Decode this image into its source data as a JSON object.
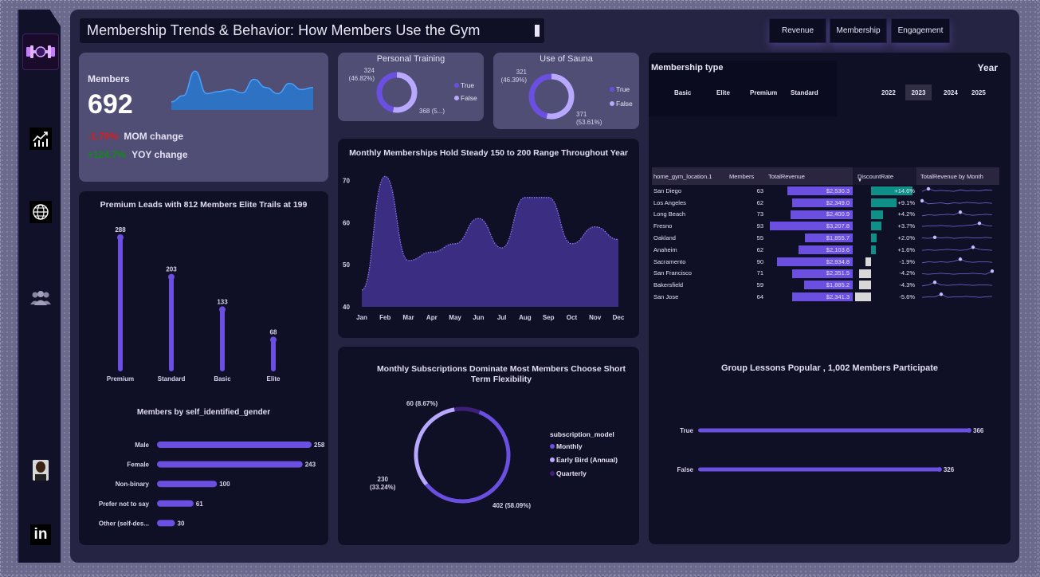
{
  "colors": {
    "accent": "#6a4fe0",
    "accent_light": "#b9a8ff",
    "accent_dark": "#3e1f78",
    "negative": "#e01b1b",
    "positive": "#0f8a1a",
    "teal": "#0e8f87",
    "panel": "#0f0f26",
    "kpi_panel": "#504e74"
  },
  "title": "Membership Trends  & Behavior: How Members Use the Gym",
  "nav_buttons": [
    "Revenue",
    "Membership",
    "Engagement"
  ],
  "sidebar_icons": [
    "gym-logo-icon",
    "line-chart-icon",
    "globe-icon",
    "users-icon",
    "profile-photo",
    "linkedin-icon"
  ],
  "kpi": {
    "label": "Members",
    "value": "692",
    "mom_value": "-1.70%",
    "mom_label": "MOM change",
    "yoy_value": "+124.7%",
    "yoy_label": "YOY change"
  },
  "personal_training": {
    "title": "Personal Training",
    "true_label": "324\n(46.82%)",
    "false_label": "368 (5...)",
    "legend": [
      "True",
      "False"
    ],
    "chart_data": {
      "type": "pie",
      "categories": [
        "True",
        "False"
      ],
      "values": [
        324,
        368
      ]
    }
  },
  "sauna": {
    "title": "Use of Sauna",
    "true_label": "321\n(46.39%)",
    "false_label": "371\n(53.61%)",
    "legend": [
      "True",
      "False"
    ],
    "chart_data": {
      "type": "pie",
      "categories": [
        "True",
        "False"
      ],
      "values": [
        321,
        371
      ]
    }
  },
  "membership_type": {
    "title": "Membership type",
    "options": [
      "Basic",
      "Elite",
      "Premium",
      "Standard"
    ]
  },
  "year": {
    "title": "Year",
    "options": [
      "2022",
      "2023",
      "2024",
      "2025"
    ],
    "selected": "2023"
  },
  "premium_chart": {
    "title": "Premium Leads with 812 Members Elite Trails at 199",
    "chart_data": {
      "type": "bar",
      "categories": [
        "Premium",
        "Standard",
        "Basic",
        "Elite"
      ],
      "values": [
        288,
        203,
        133,
        68
      ]
    }
  },
  "monthly_chart": {
    "title": "Monthly Memberships Hold Steady 150 to 200 Range Throughout Year",
    "chart_data": {
      "type": "area",
      "categories": [
        "Jan",
        "Feb",
        "Mar",
        "Apr",
        "May",
        "Jun",
        "Jul",
        "Aug",
        "Sep",
        "Oct",
        "Nov",
        "Dec"
      ],
      "values": [
        44,
        71,
        51,
        53,
        55,
        61,
        54,
        66,
        66,
        55,
        59,
        56
      ],
      "y_ticks": [
        "70",
        "60",
        "50",
        "40"
      ],
      "ylim": [
        40,
        72
      ]
    }
  },
  "gender_chart": {
    "title": "Members by self_identified_gender",
    "chart_data": {
      "type": "bar",
      "categories": [
        "Male",
        "Female",
        "Non-binary",
        "Prefer not to say",
        "Other (self-des..."
      ],
      "values": [
        258,
        243,
        100,
        61,
        30
      ]
    }
  },
  "subscription_chart": {
    "title": "Monthly Subscriptions Dominate Most Members Choose Short Term Flexibility",
    "legend_title": "subscription_model",
    "labels": [
      "402 (58.09%)",
      "230\n(33.24%)",
      "60 (8.67%)"
    ],
    "chart_data": {
      "type": "pie",
      "categories": [
        "Monthly",
        "Early Bird (Annual)",
        "Quarterly"
      ],
      "values": [
        402,
        230,
        60
      ]
    }
  },
  "location_table": {
    "headers": [
      "home_gym_location.1",
      "Members",
      "TotalRevenue",
      "DiscountRate",
      "TotalRevenue by Month"
    ],
    "rows": [
      {
        "location": "San Diego",
        "members": "63",
        "revenue": "$2,530.3",
        "rev_num": 2530.3,
        "discount": "+14.6%",
        "disc_num": 14.6,
        "spark": [
          0.45,
          0.7,
          0.5,
          0.55,
          0.5,
          0.45,
          0.6,
          0.5,
          0.55,
          0.5,
          0.6,
          0.55
        ]
      },
      {
        "location": "Los Angeles",
        "members": "62",
        "revenue": "$2,349.0",
        "rev_num": 2349.0,
        "discount": "+9.1%",
        "disc_num": 9.1,
        "spark": [
          0.7,
          0.4,
          0.45,
          0.5,
          0.4,
          0.5,
          0.45,
          0.55,
          0.5,
          0.45,
          0.5,
          0.45
        ]
      },
      {
        "location": "Long Beach",
        "members": "73",
        "revenue": "$2,400.9",
        "rev_num": 2400.9,
        "discount": "+4.2%",
        "disc_num": 4.2,
        "spark": [
          0.4,
          0.5,
          0.45,
          0.5,
          0.55,
          0.5,
          0.75,
          0.5,
          0.45,
          0.5,
          0.55,
          0.5
        ]
      },
      {
        "location": "Fresno",
        "members": "93",
        "revenue": "$3,207.8",
        "rev_num": 3207.8,
        "discount": "+3.7%",
        "disc_num": 3.7,
        "spark": [
          0.45,
          0.5,
          0.5,
          0.55,
          0.5,
          0.45,
          0.5,
          0.55,
          0.6,
          0.75,
          0.55,
          0.5
        ]
      },
      {
        "location": "Oakland",
        "members": "55",
        "revenue": "$1,855.7",
        "rev_num": 1855.7,
        "discount": "+2.0%",
        "disc_num": 2.0,
        "spark": [
          0.5,
          0.45,
          0.55,
          0.5,
          0.55,
          0.45,
          0.5,
          0.55,
          0.5,
          0.5,
          0.55,
          0.5
        ]
      },
      {
        "location": "Anaheim",
        "members": "62",
        "revenue": "$2,103.6",
        "rev_num": 2103.6,
        "discount": "+1.6%",
        "disc_num": 1.6,
        "spark": [
          0.45,
          0.5,
          0.45,
          0.5,
          0.55,
          0.5,
          0.45,
          0.5,
          0.75,
          0.55,
          0.5,
          0.45
        ]
      },
      {
        "location": "Sacramento",
        "members": "90",
        "revenue": "$2,934.8",
        "rev_num": 2934.8,
        "discount": "-1.9%",
        "disc_num": -1.9,
        "spark": [
          0.4,
          0.5,
          0.45,
          0.5,
          0.45,
          0.55,
          0.75,
          0.5,
          0.45,
          0.5,
          0.5,
          0.45
        ]
      },
      {
        "location": "San Francisco",
        "members": "71",
        "revenue": "$2,351.5",
        "rev_num": 2351.5,
        "discount": "-4.2%",
        "disc_num": -4.2,
        "spark": [
          0.5,
          0.45,
          0.5,
          0.55,
          0.5,
          0.45,
          0.5,
          0.5,
          0.55,
          0.5,
          0.45,
          0.75
        ]
      },
      {
        "location": "Bakersfield",
        "members": "59",
        "revenue": "$1,885.2",
        "rev_num": 1885.2,
        "discount": "-4.3%",
        "disc_num": -4.3,
        "spark": [
          0.4,
          0.5,
          0.75,
          0.5,
          0.45,
          0.5,
          0.55,
          0.5,
          0.45,
          0.5,
          0.5,
          0.45
        ]
      },
      {
        "location": "San Jose",
        "members": "64",
        "revenue": "$2,341.3",
        "rev_num": 2341.3,
        "discount": "-5.6%",
        "disc_num": -5.6,
        "spark": [
          0.45,
          0.5,
          0.5,
          0.75,
          0.45,
          0.5,
          0.5,
          0.55,
          0.5,
          0.45,
          0.5,
          0.55
        ]
      }
    ]
  },
  "group_lessons_chart": {
    "title": "Group Lessons Popular , 1,002 Members Participate",
    "chart_data": {
      "type": "bar",
      "categories": [
        "True",
        "False"
      ],
      "values": [
        366,
        326
      ]
    }
  },
  "kpi_sparkline": {
    "chart_data": {
      "type": "area",
      "values": [
        0.2,
        0.35,
        0.95,
        0.4,
        0.45,
        0.5,
        0.42,
        0.75,
        0.55,
        0.4,
        0.65,
        0.5,
        0.55
      ]
    }
  }
}
